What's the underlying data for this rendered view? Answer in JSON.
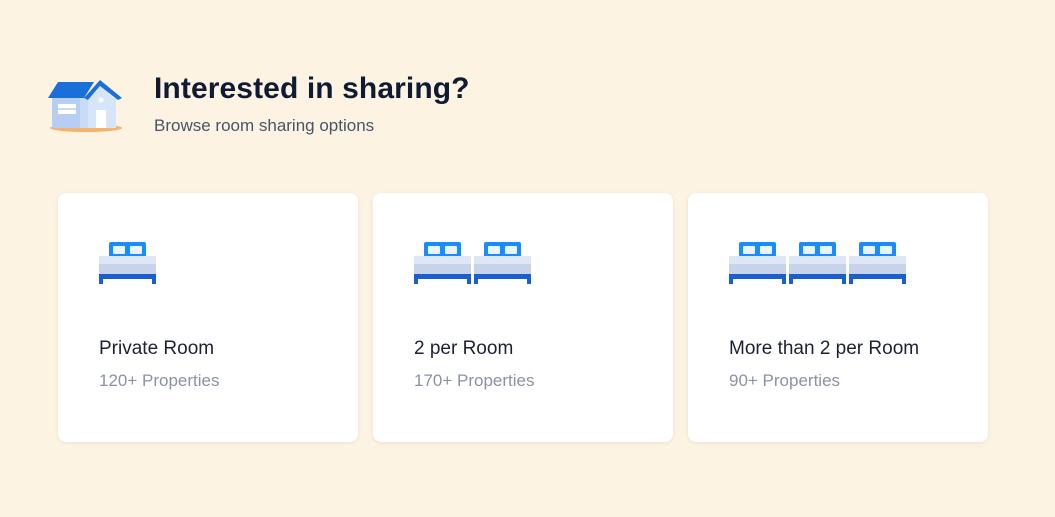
{
  "header": {
    "title": "Interested in sharing?",
    "subtitle": "Browse room sharing options",
    "icon": "house-icon"
  },
  "options": [
    {
      "label": "Private Room",
      "count": "120+ Properties",
      "beds": 1,
      "icon": "bed-icon"
    },
    {
      "label": "2 per Room",
      "count": "170+ Properties",
      "beds": 2,
      "icon": "bed-icon"
    },
    {
      "label": "More than 2 per Room",
      "count": "90+ Properties",
      "beds": 3,
      "icon": "bed-icon"
    }
  ],
  "colors": {
    "background": "#fdf3e3",
    "accent_blue": "#1a8cff",
    "title_text": "#0f1a33"
  }
}
